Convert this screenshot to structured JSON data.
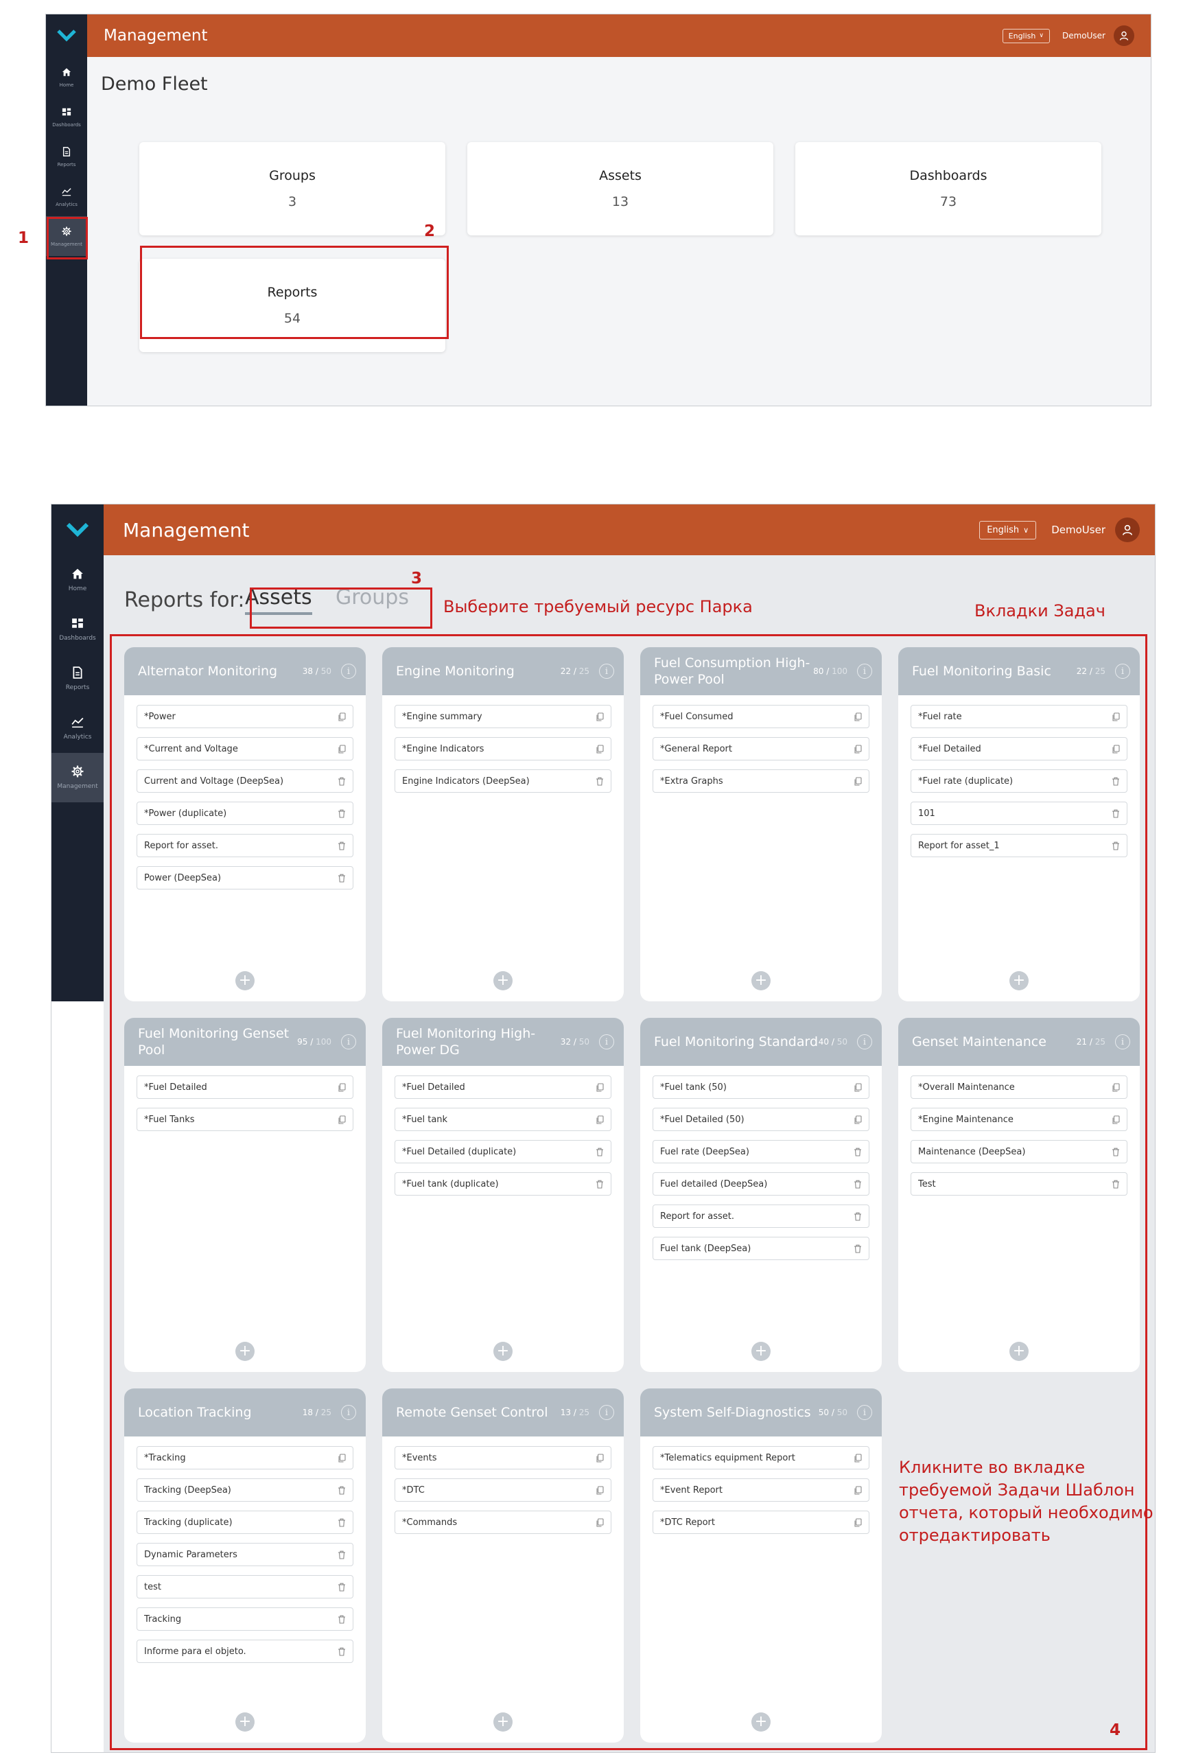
{
  "nav": [
    {
      "key": "home",
      "label": "Home",
      "icon": "home-icon"
    },
    {
      "key": "dashboards",
      "label": "Dashboards",
      "icon": "dashboards-icon"
    },
    {
      "key": "reports",
      "label": "Reports",
      "icon": "reports-icon"
    },
    {
      "key": "analytics",
      "label": "Analytics",
      "icon": "analytics-icon"
    },
    {
      "key": "management",
      "label": "Management",
      "icon": "gear-icon"
    }
  ],
  "header": {
    "title": "Management",
    "language": "English",
    "user": "DemoUser"
  },
  "colors": {
    "header": "#bf5429",
    "sidebar": "#1b2230",
    "logo": "#1fb5d6",
    "annotation": "#c41e1e"
  },
  "screen1": {
    "fleet_name": "Demo Fleet",
    "stats": [
      {
        "label": "Groups",
        "value": "3"
      },
      {
        "label": "Assets",
        "value": "13"
      },
      {
        "label": "Dashboards",
        "value": "73"
      },
      {
        "label": "Reports",
        "value": "54"
      }
    ]
  },
  "screen2": {
    "reports_for_label": "Reports for:",
    "tabs": [
      {
        "label": "Assets",
        "active": true
      },
      {
        "label": "Groups",
        "active": false
      }
    ],
    "tasks": [
      {
        "name": "Alternator Monitoring",
        "used": "38",
        "max": "50",
        "reports": [
          {
            "name": "*Power",
            "icon": "copy"
          },
          {
            "name": "*Current and Voltage",
            "icon": "copy"
          },
          {
            "name": "Current and Voltage (DeepSea)",
            "icon": "trash"
          },
          {
            "name": "*Power (duplicate)",
            "icon": "trash"
          },
          {
            "name": "Report for asset.",
            "icon": "trash"
          },
          {
            "name": "Power (DeepSea)",
            "icon": "trash"
          }
        ]
      },
      {
        "name": "Engine Monitoring",
        "used": "22",
        "max": "25",
        "reports": [
          {
            "name": "*Engine summary",
            "icon": "copy"
          },
          {
            "name": "*Engine Indicators",
            "icon": "copy"
          },
          {
            "name": "Engine Indicators (DeepSea)",
            "icon": "trash"
          }
        ]
      },
      {
        "name": "Fuel Consumption High-Power Pool",
        "used": "80",
        "max": "100",
        "reports": [
          {
            "name": "*Fuel Consumed",
            "icon": "copy"
          },
          {
            "name": "*General Report",
            "icon": "copy"
          },
          {
            "name": "*Extra Graphs",
            "icon": "copy"
          }
        ]
      },
      {
        "name": "Fuel Monitoring Basic",
        "used": "22",
        "max": "25",
        "reports": [
          {
            "name": "*Fuel rate",
            "icon": "copy"
          },
          {
            "name": "*Fuel Detailed",
            "icon": "copy"
          },
          {
            "name": "*Fuel rate (duplicate)",
            "icon": "trash"
          },
          {
            "name": "101",
            "icon": "trash"
          },
          {
            "name": "Report for asset_1",
            "icon": "trash"
          }
        ]
      },
      {
        "name": "Fuel Monitoring Genset Pool",
        "used": "95",
        "max": "100",
        "reports": [
          {
            "name": "*Fuel Detailed",
            "icon": "copy"
          },
          {
            "name": "*Fuel Tanks",
            "icon": "copy"
          }
        ]
      },
      {
        "name": "Fuel Monitoring High-Power DG",
        "used": "32",
        "max": "50",
        "reports": [
          {
            "name": "*Fuel Detailed",
            "icon": "copy"
          },
          {
            "name": "*Fuel tank",
            "icon": "copy"
          },
          {
            "name": "*Fuel Detailed (duplicate)",
            "icon": "trash"
          },
          {
            "name": "*Fuel tank (duplicate)",
            "icon": "trash"
          }
        ]
      },
      {
        "name": "Fuel Monitoring Standard",
        "used": "40",
        "max": "50",
        "reports": [
          {
            "name": "*Fuel tank (50)",
            "icon": "copy"
          },
          {
            "name": "*Fuel Detailed (50)",
            "icon": "copy"
          },
          {
            "name": "Fuel rate (DeepSea)",
            "icon": "trash"
          },
          {
            "name": "Fuel detailed (DeepSea)",
            "icon": "trash"
          },
          {
            "name": "Report for asset.",
            "icon": "trash"
          },
          {
            "name": "Fuel tank (DeepSea)",
            "icon": "trash"
          }
        ]
      },
      {
        "name": "Genset Maintenance",
        "used": "21",
        "max": "25",
        "reports": [
          {
            "name": "*Overall Maintenance",
            "icon": "copy"
          },
          {
            "name": "*Engine Maintenance",
            "icon": "copy"
          },
          {
            "name": "Maintenance (DeepSea)",
            "icon": "trash"
          },
          {
            "name": "Test",
            "icon": "trash"
          }
        ]
      },
      {
        "name": "Location Tracking",
        "used": "18",
        "max": "25",
        "reports": [
          {
            "name": "*Tracking",
            "icon": "copy"
          },
          {
            "name": "Tracking (DeepSea)",
            "icon": "trash"
          },
          {
            "name": "Tracking (duplicate)",
            "icon": "trash"
          },
          {
            "name": "Dynamic Parameters",
            "icon": "trash"
          },
          {
            "name": "test",
            "icon": "trash"
          },
          {
            "name": "Tracking",
            "icon": "trash"
          },
          {
            "name": "Informe para el objeto.",
            "icon": "trash"
          }
        ]
      },
      {
        "name": "Remote Genset Control",
        "used": "13",
        "max": "25",
        "reports": [
          {
            "name": "*Events",
            "icon": "copy"
          },
          {
            "name": "*DTC",
            "icon": "copy"
          },
          {
            "name": "*Commands",
            "icon": "copy"
          }
        ]
      },
      {
        "name": "System Self-Diagnostics",
        "used": "50",
        "max": "50",
        "reports": [
          {
            "name": "*Telematics equipment Report",
            "icon": "copy"
          },
          {
            "name": "*Event Report",
            "icon": "copy"
          },
          {
            "name": "*DTC Report",
            "icon": "copy"
          }
        ]
      }
    ]
  },
  "annotations": {
    "n1": "1",
    "n2": "2",
    "n3": "3",
    "n4": "4",
    "choose_resource": "Выберите требуемый ресурс Парка",
    "task_tabs": "Вкладки Задач",
    "click_hint_lines": [
      "Кликните во вкладке",
      "требуемой Задачи Шаблон",
      "отчета, который необходимо",
      "отредактировать"
    ]
  }
}
